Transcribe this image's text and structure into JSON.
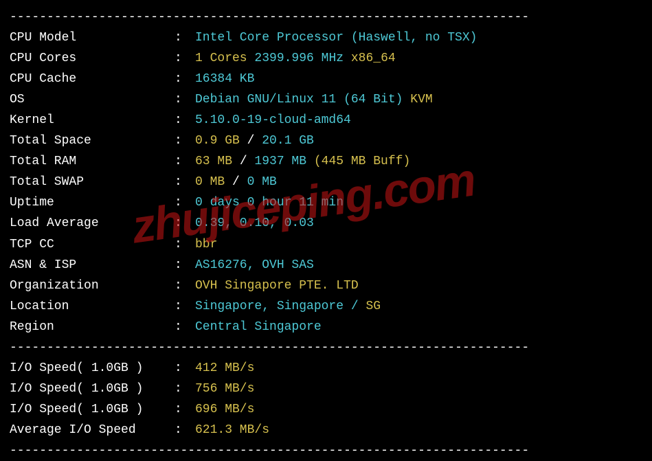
{
  "divider": "----------------------------------------------------------------------",
  "watermark": "zhujiceping.com",
  "rows": [
    {
      "label": "CPU Model",
      "segments": [
        {
          "text": "Intel Core Processor (Haswell, no TSX)",
          "cls": "cyan"
        }
      ]
    },
    {
      "label": "CPU Cores",
      "segments": [
        {
          "text": "1 Cores ",
          "cls": "yellow"
        },
        {
          "text": "2399.996 MHz ",
          "cls": "cyan"
        },
        {
          "text": "x86_64",
          "cls": "yellow"
        }
      ]
    },
    {
      "label": "CPU Cache",
      "segments": [
        {
          "text": "16384 KB",
          "cls": "cyan"
        }
      ]
    },
    {
      "label": "OS",
      "segments": [
        {
          "text": "Debian GNU/Linux 11 (64 Bit) ",
          "cls": "cyan"
        },
        {
          "text": "KVM",
          "cls": "yellow"
        }
      ]
    },
    {
      "label": "Kernel",
      "segments": [
        {
          "text": "5.10.0-19-cloud-amd64",
          "cls": "cyan"
        }
      ]
    },
    {
      "label": "Total Space",
      "segments": [
        {
          "text": "0.9 GB ",
          "cls": "yellow"
        },
        {
          "text": "/ ",
          "cls": "white"
        },
        {
          "text": "20.1 GB",
          "cls": "cyan"
        }
      ]
    },
    {
      "label": "Total RAM",
      "segments": [
        {
          "text": "63 MB ",
          "cls": "yellow"
        },
        {
          "text": "/ ",
          "cls": "white"
        },
        {
          "text": "1937 MB ",
          "cls": "cyan"
        },
        {
          "text": "(445 MB Buff)",
          "cls": "yellow"
        }
      ]
    },
    {
      "label": "Total SWAP",
      "segments": [
        {
          "text": "0 MB ",
          "cls": "yellow"
        },
        {
          "text": "/ ",
          "cls": "white"
        },
        {
          "text": "0 MB",
          "cls": "cyan"
        }
      ]
    },
    {
      "label": "Uptime",
      "segments": [
        {
          "text": "0 days 0 hour 11 min",
          "cls": "cyan"
        }
      ]
    },
    {
      "label": "Load Average",
      "segments": [
        {
          "text": "0.39, 0.10, 0.03",
          "cls": "cyan"
        }
      ]
    },
    {
      "label": "TCP CC",
      "segments": [
        {
          "text": "bbr",
          "cls": "yellow"
        }
      ]
    },
    {
      "label": "ASN & ISP",
      "segments": [
        {
          "text": "AS16276, OVH SAS",
          "cls": "cyan"
        }
      ]
    },
    {
      "label": "Organization",
      "segments": [
        {
          "text": "OVH Singapore PTE. LTD",
          "cls": "yellow"
        }
      ]
    },
    {
      "label": "Location",
      "segments": [
        {
          "text": "Singapore, Singapore / ",
          "cls": "cyan"
        },
        {
          "text": "SG",
          "cls": "yellow"
        }
      ]
    },
    {
      "label": "Region",
      "segments": [
        {
          "text": "Central Singapore",
          "cls": "cyan"
        }
      ]
    }
  ],
  "io_rows": [
    {
      "label": "I/O Speed( 1.0GB )",
      "segments": [
        {
          "text": "412 MB/s",
          "cls": "yellow"
        }
      ]
    },
    {
      "label": "I/O Speed( 1.0GB )",
      "segments": [
        {
          "text": "756 MB/s",
          "cls": "yellow"
        }
      ]
    },
    {
      "label": "I/O Speed( 1.0GB )",
      "segments": [
        {
          "text": "696 MB/s",
          "cls": "yellow"
        }
      ]
    },
    {
      "label": "Average I/O Speed",
      "segments": [
        {
          "text": "621.3 MB/s",
          "cls": "yellow"
        }
      ]
    }
  ]
}
